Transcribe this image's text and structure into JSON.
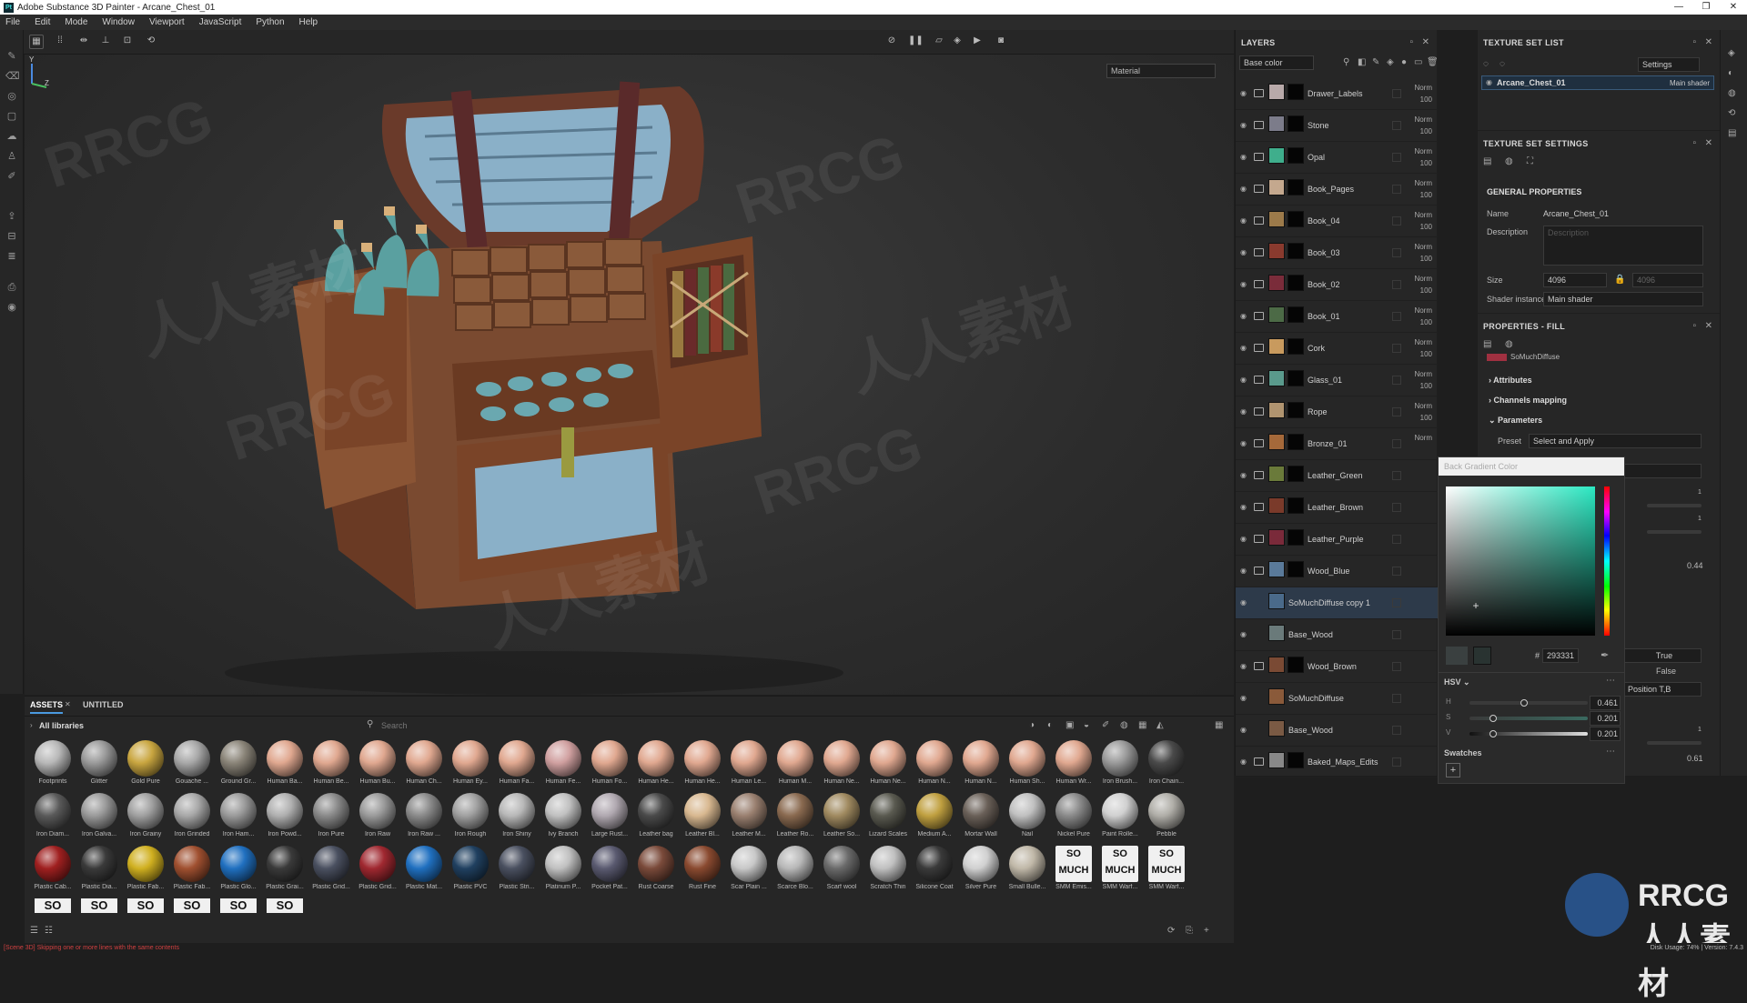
{
  "window": {
    "title": "Adobe Substance 3D Painter - Arcane_Chest_01",
    "controls": [
      "—",
      "❐",
      "✕"
    ]
  },
  "menu": [
    "File",
    "Edit",
    "Mode",
    "Window",
    "Viewport",
    "JavaScript",
    "Python",
    "Help"
  ],
  "viewport": {
    "material_mode": "Material",
    "axis_labels": {
      "y": "Y",
      "z": "Z"
    }
  },
  "watermarks": [
    "RRCG",
    "人人素材"
  ],
  "layers": {
    "title": "LAYERS",
    "channel": "Base color",
    "items": [
      {
        "name": "Drawer_Labels",
        "folder": true,
        "blend": "Norm",
        "opacity": "100",
        "color": "#b8a9a9",
        "selected": false
      },
      {
        "name": "Stone",
        "folder": true,
        "blend": "Norm",
        "opacity": "100",
        "color": "#7c7c8a",
        "selected": false
      },
      {
        "name": "Opal",
        "folder": true,
        "blend": "Norm",
        "opacity": "100",
        "color": "#3fae8c",
        "selected": false
      },
      {
        "name": "Book_Pages",
        "folder": true,
        "blend": "Norm",
        "opacity": "100",
        "color": "#c4a88e",
        "selected": false
      },
      {
        "name": "Book_04",
        "folder": true,
        "blend": "Norm",
        "opacity": "100",
        "color": "#9c7a4a",
        "selected": false
      },
      {
        "name": "Book_03",
        "folder": true,
        "blend": "Norm",
        "opacity": "100",
        "color": "#8a3a2e",
        "selected": false
      },
      {
        "name": "Book_02",
        "folder": true,
        "blend": "Norm",
        "opacity": "100",
        "color": "#7a2c3a",
        "selected": false
      },
      {
        "name": "Book_01",
        "folder": true,
        "blend": "Norm",
        "opacity": "100",
        "color": "#4c6a46",
        "selected": false
      },
      {
        "name": "Cork",
        "folder": true,
        "blend": "Norm",
        "opacity": "100",
        "color": "#c89a5e",
        "selected": false
      },
      {
        "name": "Glass_01",
        "folder": true,
        "blend": "Norm",
        "opacity": "100",
        "color": "#5a9a8c",
        "selected": false
      },
      {
        "name": "Rope",
        "folder": true,
        "blend": "Norm",
        "opacity": "100",
        "color": "#b09470",
        "selected": false
      },
      {
        "name": "Bronze_01",
        "folder": true,
        "blend": "Norm",
        "opacity": "",
        "color": "#a5693a",
        "selected": false
      },
      {
        "name": "Leather_Green",
        "folder": true,
        "blend": "",
        "opacity": "",
        "color": "#6a7a3a",
        "selected": false
      },
      {
        "name": "Leather_Brown",
        "folder": true,
        "blend": "",
        "opacity": "",
        "color": "#7a3a2a",
        "selected": false
      },
      {
        "name": "Leather_Purple",
        "folder": true,
        "blend": "",
        "opacity": "",
        "color": "#7a2a3a",
        "selected": false
      },
      {
        "name": "Wood_Blue",
        "folder": true,
        "blend": "",
        "opacity": "",
        "color": "#5a7a9a",
        "selected": false
      },
      {
        "name": "SoMuchDiffuse copy 1",
        "folder": false,
        "blend": "",
        "opacity": "",
        "color": "#4a6a8a",
        "selected": true
      },
      {
        "name": "Base_Wood",
        "folder": false,
        "blend": "",
        "opacity": "",
        "color": "#6a7a7a",
        "selected": false
      },
      {
        "name": "Wood_Brown",
        "folder": true,
        "blend": "",
        "opacity": "",
        "color": "#7a4a34",
        "selected": false
      },
      {
        "name": "SoMuchDiffuse",
        "folder": false,
        "blend": "",
        "opacity": "",
        "color": "#8a5a3a",
        "selected": false
      },
      {
        "name": "Base_Wood",
        "folder": false,
        "blend": "",
        "opacity": "",
        "color": "#7a5a44",
        "selected": false
      },
      {
        "name": "Baked_Maps_Edits",
        "folder": true,
        "blend": "",
        "opacity": "",
        "color": "#888888",
        "selected": false
      }
    ]
  },
  "texture_set_list": {
    "title": "TEXTURE SET LIST",
    "settings_label": "Settings",
    "item_name": "Arcane_Chest_01",
    "item_shader": "Main shader"
  },
  "texture_set_settings": {
    "title": "TEXTURE SET SETTINGS",
    "section": "GENERAL PROPERTIES",
    "name_label": "Name",
    "name_value": "Arcane_Chest_01",
    "description_label": "Description",
    "description_placeholder": "Description",
    "size_label": "Size",
    "size_value": "4096",
    "size_value2": "4096",
    "shader_label": "Shader instance",
    "shader_value": "Main shader"
  },
  "properties_fill": {
    "title": "PROPERTIES - FILL",
    "resource_name": "SoMuchDiffuse",
    "attributes": "Attributes",
    "channels_mapping": "Channels mapping",
    "parameters": "Parameters",
    "preset_label": "Preset",
    "preset_value": "Select and Apply",
    "slider_max_1": "1",
    "slider_max_2": "1",
    "value_044": "0.44",
    "true_label": "True",
    "false_label": "False",
    "position_dd": "Position T,B",
    "slider_max_3": "1",
    "value_061": "0.61"
  },
  "color_picker": {
    "title": "Back Gradient Color",
    "hex_label": "#",
    "hex_value": "293331",
    "mode": "HSV",
    "h_label": "H",
    "h_value": "0.461",
    "s_label": "S",
    "s_value": "0.201",
    "v_label": "V",
    "v_value": "0.201",
    "swatches_label": "Swatches",
    "add_swatch": "+",
    "h_fraction": 0.461,
    "s_fraction": 0.201,
    "v_fraction": 0.201
  },
  "assets": {
    "tabs": [
      "ASSETS",
      "UNTITLED"
    ],
    "library": "All libraries",
    "search_placeholder": "Search",
    "items": [
      {
        "name": "Footprints",
        "color": "#b8b8b8"
      },
      {
        "name": "Glitter",
        "color": "#9a9a9a"
      },
      {
        "name": "Gold Pure",
        "color": "#c9a640"
      },
      {
        "name": "Gouache ...",
        "color": "#a8a8a8"
      },
      {
        "name": "Ground Gr...",
        "color": "#8a8478"
      },
      {
        "name": "Human Ba...",
        "color": "#e0a890"
      },
      {
        "name": "Human Be...",
        "color": "#e0a890"
      },
      {
        "name": "Human Bu...",
        "color": "#e0a890"
      },
      {
        "name": "Human Ch...",
        "color": "#e0a890"
      },
      {
        "name": "Human Ey...",
        "color": "#e0a890"
      },
      {
        "name": "Human Fa...",
        "color": "#e0a890"
      },
      {
        "name": "Human Fe...",
        "color": "#d0a0a0"
      },
      {
        "name": "Human Fo...",
        "color": "#e0a890"
      },
      {
        "name": "Human He...",
        "color": "#e0a890"
      },
      {
        "name": "Human He...",
        "color": "#e0a890"
      },
      {
        "name": "Human Le...",
        "color": "#e0a890"
      },
      {
        "name": "Human M...",
        "color": "#e0a890"
      },
      {
        "name": "Human Ne...",
        "color": "#e0a890"
      },
      {
        "name": "Human Ne...",
        "color": "#e0a890"
      },
      {
        "name": "Human N...",
        "color": "#e0a890"
      },
      {
        "name": "Human N...",
        "color": "#e0a890"
      },
      {
        "name": "Human Sh...",
        "color": "#e0a890"
      },
      {
        "name": "Human Wr...",
        "color": "#e0a890"
      },
      {
        "name": "Iron Brush...",
        "color": "#9a9a9a"
      },
      {
        "name": "Iron Chain...",
        "color": "#4a4a4a"
      },
      {
        "name": "Iron Diam...",
        "color": "#5a5a5a"
      },
      {
        "name": "Iron Galva...",
        "color": "#9a9a9a"
      },
      {
        "name": "Iron Grainy",
        "color": "#a0a0a0"
      },
      {
        "name": "Iron Grinded",
        "color": "#a8a8a8"
      },
      {
        "name": "Iron Ham...",
        "color": "#9a9a9a"
      },
      {
        "name": "Iron Powd...",
        "color": "#b0b0b0"
      },
      {
        "name": "Iron Pure",
        "color": "#8a8a8a"
      },
      {
        "name": "Iron Raw",
        "color": "#9a9a9a"
      },
      {
        "name": "Iron Raw ...",
        "color": "#8a8a8a"
      },
      {
        "name": "Iron Rough",
        "color": "#a0a0a0"
      },
      {
        "name": "Iron Shiny",
        "color": "#b8b8b8"
      },
      {
        "name": "Ivy Branch",
        "color": "#c0c0c0"
      },
      {
        "name": "Large Rust...",
        "color": "#b0a8b0"
      },
      {
        "name": "Leather bag",
        "color": "#4a4a4a"
      },
      {
        "name": "Leather Bl...",
        "color": "#d8b890"
      },
      {
        "name": "Leather M...",
        "color": "#9a8070"
      },
      {
        "name": "Leather Ro...",
        "color": "#8a6a50"
      },
      {
        "name": "Leather So...",
        "color": "#a08a60"
      },
      {
        "name": "Lizard Scales",
        "color": "#5a5a50"
      },
      {
        "name": "Medium A...",
        "color": "#c0a040"
      },
      {
        "name": "Mortar Wall",
        "color": "#6a6058"
      },
      {
        "name": "Nail",
        "color": "#c0c0c0"
      },
      {
        "name": "Nickel Pure",
        "color": "#8a8a8a"
      },
      {
        "name": "Paint Rolle...",
        "color": "#d0d0d0"
      },
      {
        "name": "Pebble",
        "color": "#b0aea8"
      },
      {
        "name": "Plastic Cab...",
        "color": "#a02020"
      },
      {
        "name": "Plastic Dia...",
        "color": "#3a3a3a"
      },
      {
        "name": "Plastic Fab...",
        "color": "#d0b020"
      },
      {
        "name": "Plastic Fab...",
        "color": "#a05030"
      },
      {
        "name": "Plastic Glo...",
        "color": "#2070c0"
      },
      {
        "name": "Plastic Grai...",
        "color": "#3a3a3a"
      },
      {
        "name": "Plastic Grid...",
        "color": "#4a5060"
      },
      {
        "name": "Plastic Grid...",
        "color": "#a02830"
      },
      {
        "name": "Plastic Mat...",
        "color": "#2070c0"
      },
      {
        "name": "Plastic PVC",
        "color": "#204060"
      },
      {
        "name": "Plastic Stri...",
        "color": "#4a5060"
      },
      {
        "name": "Platinum P...",
        "color": "#c0c0c0"
      },
      {
        "name": "Pocket Pat...",
        "color": "#5a5a70"
      },
      {
        "name": "Rust Coarse",
        "color": "#7a4a3a"
      },
      {
        "name": "Rust Fine",
        "color": "#8a4a30"
      },
      {
        "name": "Scar Plain ...",
        "color": "#c8c8c8"
      },
      {
        "name": "Scarce Blo...",
        "color": "#b8b8b8"
      },
      {
        "name": "Scarf wool",
        "color": "#6a6a6a"
      },
      {
        "name": "Scratch Thin",
        "color": "#c0c0c0"
      },
      {
        "name": "Silicone Coat",
        "color": "#3a3a3a"
      },
      {
        "name": "Silver Pure",
        "color": "#d0d0d0"
      },
      {
        "name": "Small Bulle...",
        "color": "#c0b8a8"
      },
      {
        "name": "SMM Emis...",
        "color": "#f0f0f0"
      },
      {
        "name": "SMM Warf...",
        "color": "#f0f0f0"
      },
      {
        "name": "SMM Warf...",
        "color": "#f0f0f0"
      }
    ],
    "so_much_text": "SO MUCH",
    "so_text": "SO"
  },
  "status": {
    "error": "[Scene 3D] Skipping one or more lines with the same contents",
    "info": "Disk Usage: 74% | Version: 7.4.3"
  },
  "brand": "RRCG 人人素材"
}
